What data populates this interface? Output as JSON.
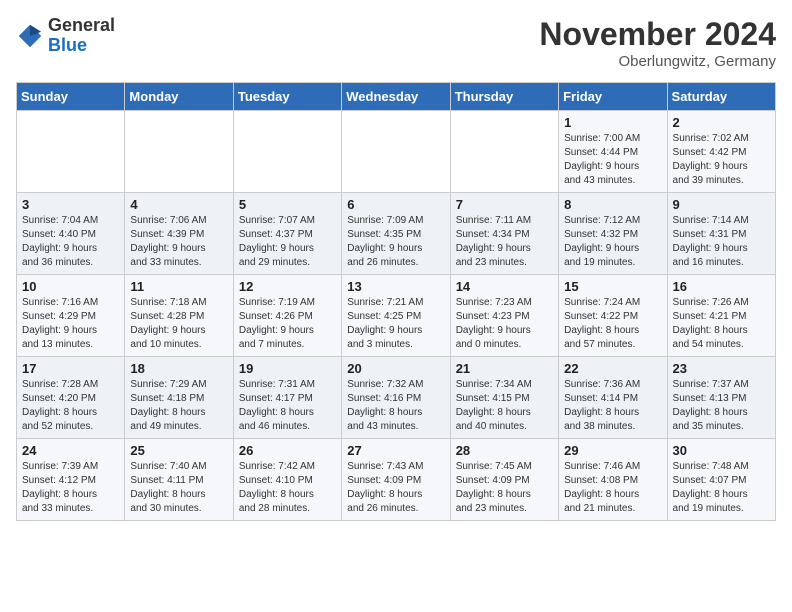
{
  "header": {
    "logo_general": "General",
    "logo_blue": "Blue",
    "month_title": "November 2024",
    "location": "Oberlungwitz, Germany"
  },
  "weekdays": [
    "Sunday",
    "Monday",
    "Tuesday",
    "Wednesday",
    "Thursday",
    "Friday",
    "Saturday"
  ],
  "weeks": [
    [
      {
        "day": "",
        "info": ""
      },
      {
        "day": "",
        "info": ""
      },
      {
        "day": "",
        "info": ""
      },
      {
        "day": "",
        "info": ""
      },
      {
        "day": "",
        "info": ""
      },
      {
        "day": "1",
        "info": "Sunrise: 7:00 AM\nSunset: 4:44 PM\nDaylight: 9 hours\nand 43 minutes."
      },
      {
        "day": "2",
        "info": "Sunrise: 7:02 AM\nSunset: 4:42 PM\nDaylight: 9 hours\nand 39 minutes."
      }
    ],
    [
      {
        "day": "3",
        "info": "Sunrise: 7:04 AM\nSunset: 4:40 PM\nDaylight: 9 hours\nand 36 minutes."
      },
      {
        "day": "4",
        "info": "Sunrise: 7:06 AM\nSunset: 4:39 PM\nDaylight: 9 hours\nand 33 minutes."
      },
      {
        "day": "5",
        "info": "Sunrise: 7:07 AM\nSunset: 4:37 PM\nDaylight: 9 hours\nand 29 minutes."
      },
      {
        "day": "6",
        "info": "Sunrise: 7:09 AM\nSunset: 4:35 PM\nDaylight: 9 hours\nand 26 minutes."
      },
      {
        "day": "7",
        "info": "Sunrise: 7:11 AM\nSunset: 4:34 PM\nDaylight: 9 hours\nand 23 minutes."
      },
      {
        "day": "8",
        "info": "Sunrise: 7:12 AM\nSunset: 4:32 PM\nDaylight: 9 hours\nand 19 minutes."
      },
      {
        "day": "9",
        "info": "Sunrise: 7:14 AM\nSunset: 4:31 PM\nDaylight: 9 hours\nand 16 minutes."
      }
    ],
    [
      {
        "day": "10",
        "info": "Sunrise: 7:16 AM\nSunset: 4:29 PM\nDaylight: 9 hours\nand 13 minutes."
      },
      {
        "day": "11",
        "info": "Sunrise: 7:18 AM\nSunset: 4:28 PM\nDaylight: 9 hours\nand 10 minutes."
      },
      {
        "day": "12",
        "info": "Sunrise: 7:19 AM\nSunset: 4:26 PM\nDaylight: 9 hours\nand 7 minutes."
      },
      {
        "day": "13",
        "info": "Sunrise: 7:21 AM\nSunset: 4:25 PM\nDaylight: 9 hours\nand 3 minutes."
      },
      {
        "day": "14",
        "info": "Sunrise: 7:23 AM\nSunset: 4:23 PM\nDaylight: 9 hours\nand 0 minutes."
      },
      {
        "day": "15",
        "info": "Sunrise: 7:24 AM\nSunset: 4:22 PM\nDaylight: 8 hours\nand 57 minutes."
      },
      {
        "day": "16",
        "info": "Sunrise: 7:26 AM\nSunset: 4:21 PM\nDaylight: 8 hours\nand 54 minutes."
      }
    ],
    [
      {
        "day": "17",
        "info": "Sunrise: 7:28 AM\nSunset: 4:20 PM\nDaylight: 8 hours\nand 52 minutes."
      },
      {
        "day": "18",
        "info": "Sunrise: 7:29 AM\nSunset: 4:18 PM\nDaylight: 8 hours\nand 49 minutes."
      },
      {
        "day": "19",
        "info": "Sunrise: 7:31 AM\nSunset: 4:17 PM\nDaylight: 8 hours\nand 46 minutes."
      },
      {
        "day": "20",
        "info": "Sunrise: 7:32 AM\nSunset: 4:16 PM\nDaylight: 8 hours\nand 43 minutes."
      },
      {
        "day": "21",
        "info": "Sunrise: 7:34 AM\nSunset: 4:15 PM\nDaylight: 8 hours\nand 40 minutes."
      },
      {
        "day": "22",
        "info": "Sunrise: 7:36 AM\nSunset: 4:14 PM\nDaylight: 8 hours\nand 38 minutes."
      },
      {
        "day": "23",
        "info": "Sunrise: 7:37 AM\nSunset: 4:13 PM\nDaylight: 8 hours\nand 35 minutes."
      }
    ],
    [
      {
        "day": "24",
        "info": "Sunrise: 7:39 AM\nSunset: 4:12 PM\nDaylight: 8 hours\nand 33 minutes."
      },
      {
        "day": "25",
        "info": "Sunrise: 7:40 AM\nSunset: 4:11 PM\nDaylight: 8 hours\nand 30 minutes."
      },
      {
        "day": "26",
        "info": "Sunrise: 7:42 AM\nSunset: 4:10 PM\nDaylight: 8 hours\nand 28 minutes."
      },
      {
        "day": "27",
        "info": "Sunrise: 7:43 AM\nSunset: 4:09 PM\nDaylight: 8 hours\nand 26 minutes."
      },
      {
        "day": "28",
        "info": "Sunrise: 7:45 AM\nSunset: 4:09 PM\nDaylight: 8 hours\nand 23 minutes."
      },
      {
        "day": "29",
        "info": "Sunrise: 7:46 AM\nSunset: 4:08 PM\nDaylight: 8 hours\nand 21 minutes."
      },
      {
        "day": "30",
        "info": "Sunrise: 7:48 AM\nSunset: 4:07 PM\nDaylight: 8 hours\nand 19 minutes."
      }
    ]
  ]
}
